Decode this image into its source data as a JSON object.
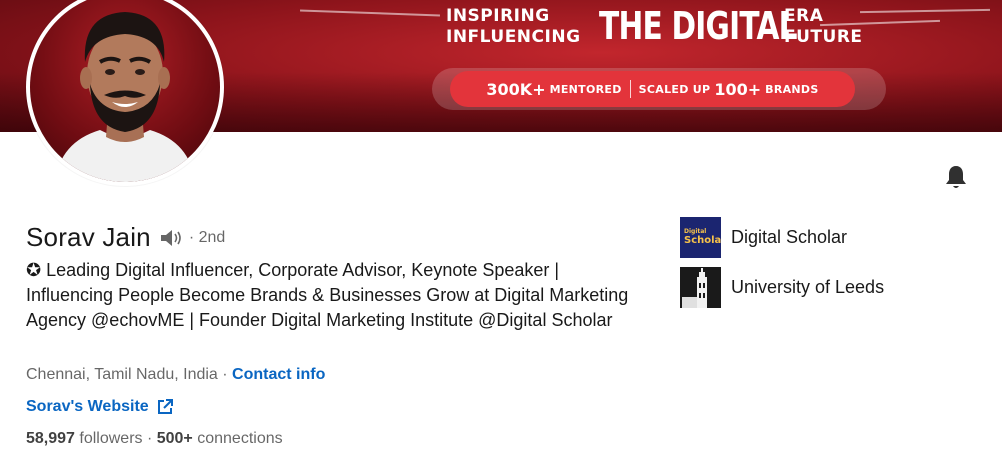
{
  "banner": {
    "slogan_left_line1": "INSPIRING",
    "slogan_left_line2": "INFLUENCING",
    "slogan_big": "THE DIGITAL",
    "slogan_right_line1": "ERA",
    "slogan_right_line2": "FUTURE",
    "stat1_bold": "300K+",
    "stat1_small": "MENTORED",
    "stat2_small": "SCALED UP",
    "stat2_bold": "100+",
    "stat2_tail": "BRANDS",
    "colors": {
      "primary": "#a9171e",
      "pill": "#e3343b"
    }
  },
  "profile": {
    "name": "Sorav Jain",
    "degree": "· 2nd",
    "headline": "✪ Leading Digital Influencer, Corporate Advisor, Keynote Speaker | Influencing People Become Brands & Businesses Grow at Digital Marketing Agency @echovME | Founder Digital Marketing Institute @Digital Scholar",
    "location": "Chennai, Tamil Nadu, India",
    "location_sep": " · ",
    "contact_info": "Contact info",
    "website": "Sorav's Website",
    "followers_count": "58,997",
    "followers_label": " followers",
    "stats_sep": "  · ",
    "connections_count": "500+",
    "connections_label": " connections",
    "link_color": "#0a66c2"
  },
  "orgs": [
    {
      "name": "Digital Scholar",
      "logo_text_small": "Digital",
      "logo_text": "Scholar"
    },
    {
      "name": "University of Leeds"
    }
  ],
  "icons": {
    "notify": "bell-icon",
    "pronunciation": "speaker-icon",
    "external": "external-link-icon"
  }
}
